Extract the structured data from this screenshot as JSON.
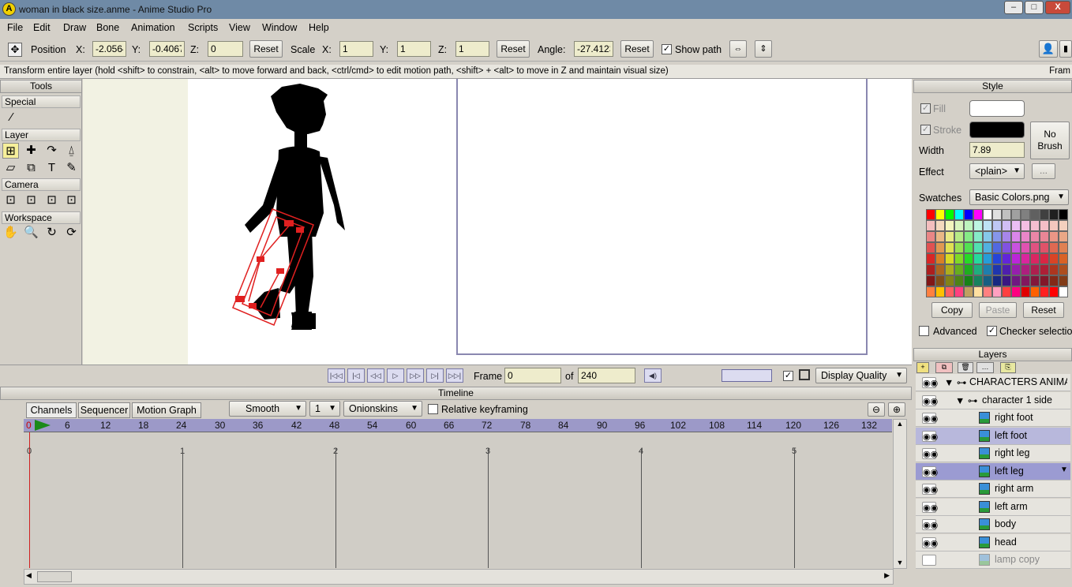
{
  "window": {
    "title": "woman in black size.anme - Anime Studio Pro",
    "app_icon_letter": "A",
    "minimize": "–",
    "maximize": "□",
    "close": "X"
  },
  "menu": [
    "File",
    "Edit",
    "Draw",
    "Bone",
    "Animation",
    "Scripts",
    "View",
    "Window",
    "Help"
  ],
  "toolbar": {
    "position_label": "Position",
    "x_label": "X:",
    "x_value": "-2.0564",
    "y_label": "Y:",
    "y_value": "-0.4067",
    "z_label": "Z:",
    "z_value": "0",
    "reset1": "Reset",
    "scale_label": "Scale",
    "sx_label": "X:",
    "sx_value": "1",
    "sy_label": "Y:",
    "sy_value": "1",
    "sz_label": "Z:",
    "sz_value": "1",
    "reset2": "Reset",
    "angle_label": "Angle:",
    "angle_value": "-27.4123",
    "reset3": "Reset",
    "show_path": "Show path"
  },
  "status": {
    "text": "Transform entire layer (hold <shift> to constrain, <alt> to move forward and back, <ctrl/cmd> to edit motion path, <shift> + <alt> to move in Z and maintain visual size)",
    "right": "Fram"
  },
  "tools": {
    "title": "Tools",
    "special": "Special",
    "layer": "Layer",
    "camera": "Camera",
    "workspace": "Workspace",
    "text_tool": "T"
  },
  "playback": {
    "frame_label": "Frame",
    "frame_value": "0",
    "of_label": "of",
    "total": "240",
    "display_quality": "Display Quality"
  },
  "timeline": {
    "title": "Timeline",
    "tabs": [
      "Channels",
      "Sequencer",
      "Motion Graph"
    ],
    "interp": "Smooth",
    "step": "1",
    "onionskins": "Onionskins",
    "relative_keyframing": "Relative keyframing",
    "ruler_start": "0",
    "ruler_ticks": [
      "6",
      "12",
      "18",
      "24",
      "30",
      "36",
      "42",
      "48",
      "54",
      "60",
      "66",
      "72",
      "78",
      "84",
      "90",
      "96",
      "102",
      "108",
      "114",
      "120",
      "126",
      "132"
    ],
    "second_marks": [
      "0",
      "1",
      "2",
      "3",
      "4",
      "5"
    ]
  },
  "style": {
    "title": "Style",
    "fill": "Fill",
    "stroke": "Stroke",
    "width_label": "Width",
    "width_value": "7.89",
    "effect_label": "Effect",
    "effect_value": "<plain>",
    "effect_more": "...",
    "no_brush": "No Brush",
    "swatches_label": "Swatches",
    "swatches_value": "Basic Colors.png",
    "copy": "Copy",
    "paste": "Paste",
    "reset": "Reset",
    "advanced": "Advanced",
    "checker": "Checker selection"
  },
  "layers": {
    "title": "Layers",
    "rows": [
      {
        "name": "CHARACTERS ANIMATE",
        "indent": 0,
        "state": "normal"
      },
      {
        "name": "character 1 side",
        "indent": 1,
        "state": "normal"
      },
      {
        "name": "right foot",
        "indent": 2,
        "state": "normal"
      },
      {
        "name": "left foot",
        "indent": 2,
        "state": "highlight"
      },
      {
        "name": "right leg",
        "indent": 2,
        "state": "normal"
      },
      {
        "name": "left leg",
        "indent": 2,
        "state": "selected"
      },
      {
        "name": "right arm",
        "indent": 2,
        "state": "normal"
      },
      {
        "name": "left arm",
        "indent": 2,
        "state": "normal"
      },
      {
        "name": "body",
        "indent": 2,
        "state": "normal"
      },
      {
        "name": "head",
        "indent": 2,
        "state": "normal"
      },
      {
        "name": "lamp copy",
        "indent": 2,
        "state": "hidden"
      }
    ]
  },
  "colors": {
    "accent_selection": "#9b9bd2",
    "ruler": "#9c99c8",
    "bone": "#e02020"
  }
}
